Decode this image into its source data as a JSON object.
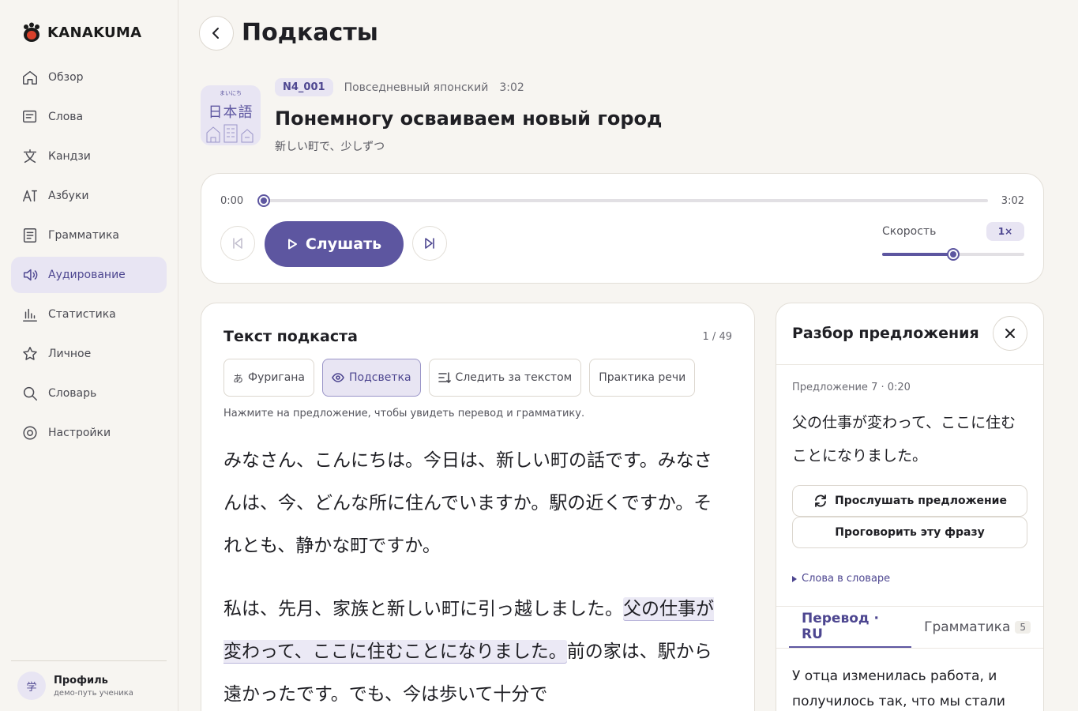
{
  "app": {
    "name": "KANAKUMA"
  },
  "sidebar": {
    "items": [
      {
        "label": "Обзор",
        "icon": "home-icon"
      },
      {
        "label": "Слова",
        "icon": "card-icon"
      },
      {
        "label": "Кандзи",
        "icon": "kanji-icon"
      },
      {
        "label": "Азбуки",
        "icon": "kana-icon"
      },
      {
        "label": "Грамматика",
        "icon": "document-icon"
      },
      {
        "label": "Аудирование",
        "icon": "speaker-icon",
        "active": true
      },
      {
        "label": "Статистика",
        "icon": "bar-chart-icon"
      },
      {
        "label": "Личное",
        "icon": "star-icon"
      },
      {
        "label": "Словарь",
        "icon": "search-icon"
      },
      {
        "label": "Настройки",
        "icon": "gear-icon"
      }
    ],
    "profile": {
      "avatar": "学",
      "name": "Профиль",
      "subtitle": "демо-путь ученика"
    }
  },
  "header": {
    "title": "Подкасты"
  },
  "episode": {
    "cover_small": "まいにち",
    "cover_big": "日本語",
    "code": "N4_001",
    "category": "Повседневный японский",
    "duration": "3:02",
    "title": "Понемногу осваиваем новый город",
    "subtitle": "新しい町で、少しずつ"
  },
  "player": {
    "time_current": "0:00",
    "time_total": "3:02",
    "progress": 0,
    "play_label": "Слушать",
    "speed_label": "Скорость",
    "speed_value": "1×",
    "speed_level": 0.5
  },
  "transcript": {
    "title": "Текст подкаста",
    "counter": "1 / 49",
    "toggles": {
      "furigana": "Фуригана",
      "highlight": "Подсветка",
      "follow": "Следить за текстом",
      "practice": "Практика речи"
    },
    "hint": "Нажмите на предложение, чтобы увидеть перевод и грамматику.",
    "p1": [
      "みなさん、こんにちは。",
      "今日は、新しい町の話です。",
      "みなさんは、今、どんな所に住んでいますか。",
      "駅の近くですか。",
      "それとも、静かな町ですか。"
    ],
    "p2": [
      "私は、先月、家族と新しい町に引っ越しました。",
      "父の仕事が変わって、ここに住むことになりました。",
      "前の家は、駅から遠かったです。",
      "でも、今は歩いて十分で"
    ]
  },
  "analysis": {
    "title": "Разбор предложения",
    "meta": "Предложение 7 · 0:20",
    "sentence": "父の仕事が変わって、ここに住むことになりました。",
    "listen_label": "Прослушать предложение",
    "speak_label": "Проговорить эту фразу",
    "dict_label": "Слова в словаре",
    "tab_translation": "Перевод · RU",
    "tab_grammar": "Грамматика",
    "grammar_count": "5",
    "translation": "У отца изменилась работа, и получилось так, что мы стали"
  },
  "colors": {
    "accent": "#5d56a0",
    "accent_soft": "#e8e5f3",
    "background": "#f7f5f1"
  }
}
